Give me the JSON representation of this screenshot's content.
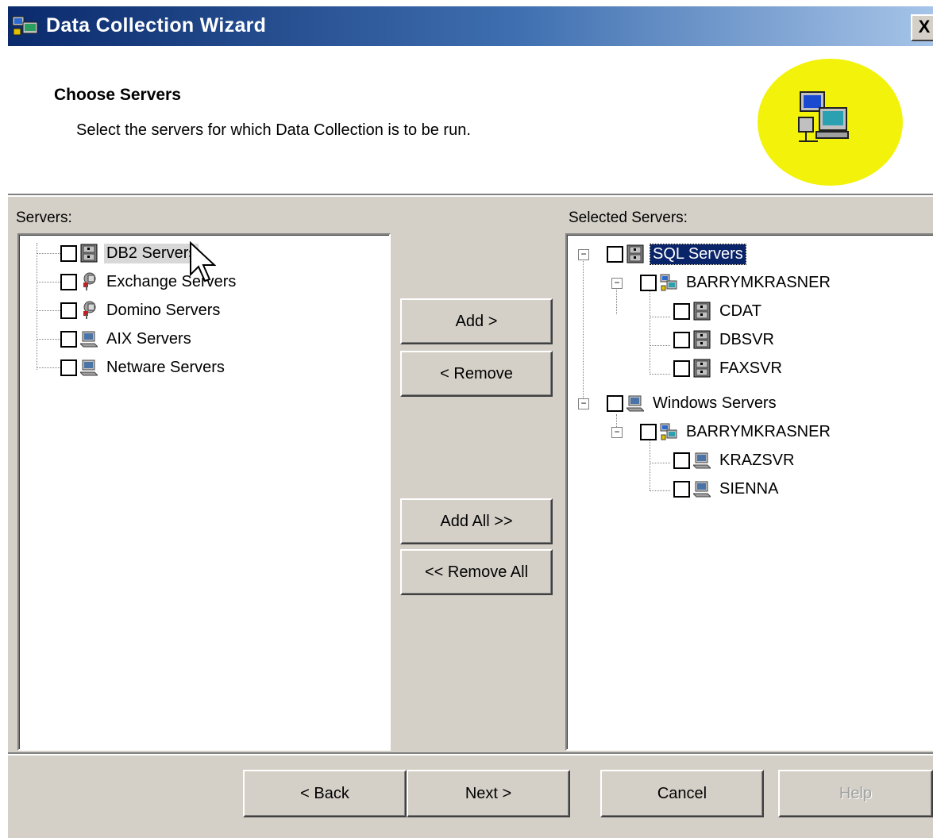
{
  "window": {
    "title": "Data Collection Wizard",
    "close_label": "X"
  },
  "header": {
    "title": "Choose Servers",
    "subtitle": "Select the servers for which Data Collection is to be run.",
    "icon": "network-computers-icon"
  },
  "left_panel": {
    "label": "Servers:",
    "items": [
      {
        "label": "DB2 Servers",
        "icon": "database-server-icon"
      },
      {
        "label": "Exchange Servers",
        "icon": "exchange-server-icon"
      },
      {
        "label": "Domino Servers",
        "icon": "domino-server-icon"
      },
      {
        "label": "AIX Servers",
        "icon": "computer-icon"
      },
      {
        "label": "Netware Servers",
        "icon": "computer-icon"
      }
    ]
  },
  "middle_buttons": {
    "add": "Add >",
    "remove": "< Remove",
    "add_all": "Add All >>",
    "remove_all": "<< Remove All"
  },
  "right_panel": {
    "label": "Selected Servers:",
    "tree": [
      {
        "label": "SQL Servers",
        "selected": true,
        "icon": "database-server-icon"
      },
      {
        "label": "BARRYMKRASNER",
        "icon": "network-computers-icon"
      },
      {
        "label": "CDAT",
        "icon": "database-server-icon"
      },
      {
        "label": "DBSVR",
        "icon": "database-server-icon"
      },
      {
        "label": "FAXSVR",
        "icon": "database-server-icon"
      },
      {
        "label": "Windows Servers",
        "icon": "computer-icon"
      },
      {
        "label": "BARRYMKRASNER",
        "icon": "network-computers-icon"
      },
      {
        "label": "KRAZSVR",
        "icon": "computer-icon"
      },
      {
        "label": "SIENNA",
        "icon": "computer-icon"
      }
    ]
  },
  "footer": {
    "back": "< Back",
    "next": "Next >",
    "cancel": "Cancel",
    "help": "Help"
  },
  "colors": {
    "titlebar_start": "#0a2a6c",
    "titlebar_end": "#a6c4e8",
    "dialog_face": "#d4d0c8",
    "selection": "#0a246a",
    "header_badge": "#f2f20a"
  }
}
